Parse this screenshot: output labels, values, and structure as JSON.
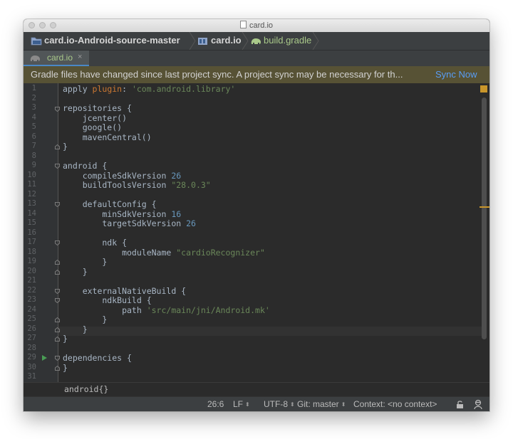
{
  "window": {
    "title": "card.io"
  },
  "navbar": {
    "crumbs": [
      {
        "label": "card.io-Android-source-master",
        "icon": "folder-icon"
      },
      {
        "label": "card.io",
        "icon": "module-icon"
      },
      {
        "label": "build.gradle",
        "icon": "gradle-elephant-icon"
      }
    ]
  },
  "tabs": [
    {
      "label": "card.io",
      "icon": "gradle-elephant-icon",
      "close": "×"
    }
  ],
  "banner": {
    "message": "Gradle files have changed since last project sync. A project sync may be necessary for th...",
    "action": "Sync Now"
  },
  "editor": {
    "line_numbers": [
      "1",
      "2",
      "3",
      "4",
      "5",
      "6",
      "7",
      "8",
      "9",
      "10",
      "11",
      "12",
      "13",
      "14",
      "15",
      "16",
      "17",
      "18",
      "19",
      "20",
      "21",
      "22",
      "23",
      "24",
      "25",
      "26",
      "27",
      "28",
      "29",
      "30",
      "31"
    ],
    "lines": {
      "l1": {
        "a": "apply ",
        "b": "plugin",
        "c": ": ",
        "d": "'com.android.library'"
      },
      "l3": "repositories {",
      "l4": "    jcenter()",
      "l5": "    google()",
      "l6": "    mavenCentral()",
      "l7": "}",
      "l9": "android {",
      "l10": {
        "a": "    compileSdkVersion ",
        "b": "26"
      },
      "l11": {
        "a": "    buildToolsVersion ",
        "b": "\"28.0.3\""
      },
      "l13": "    defaultConfig {",
      "l14": {
        "a": "        minSdkVersion ",
        "b": "16"
      },
      "l15": {
        "a": "        targetSdkVersion ",
        "b": "26"
      },
      "l17": "        ndk {",
      "l18": {
        "a": "            moduleName ",
        "b": "\"cardioRecognizer\""
      },
      "l19": "        }",
      "l20": "    }",
      "l22": "    externalNativeBuild {",
      "l23": "        ndkBuild {",
      "l24": {
        "a": "            path ",
        "b": "'src/main/jni/Android.mk'"
      },
      "l25": "        }",
      "l26": "    }",
      "l27": "}",
      "l29": "dependencies {",
      "l30": "}"
    },
    "current_line": 26,
    "colors": {
      "keyword": "#cc7832",
      "string": "#6a8759",
      "number": "#6897bb",
      "text": "#a9b7c6"
    }
  },
  "footer_breadcrumb": "android{}",
  "status": {
    "position": "26:6",
    "line_separator": "LF",
    "encoding": "UTF-8",
    "git": "Git: master",
    "context": "Context: <no context>",
    "up_down": "⬍"
  }
}
